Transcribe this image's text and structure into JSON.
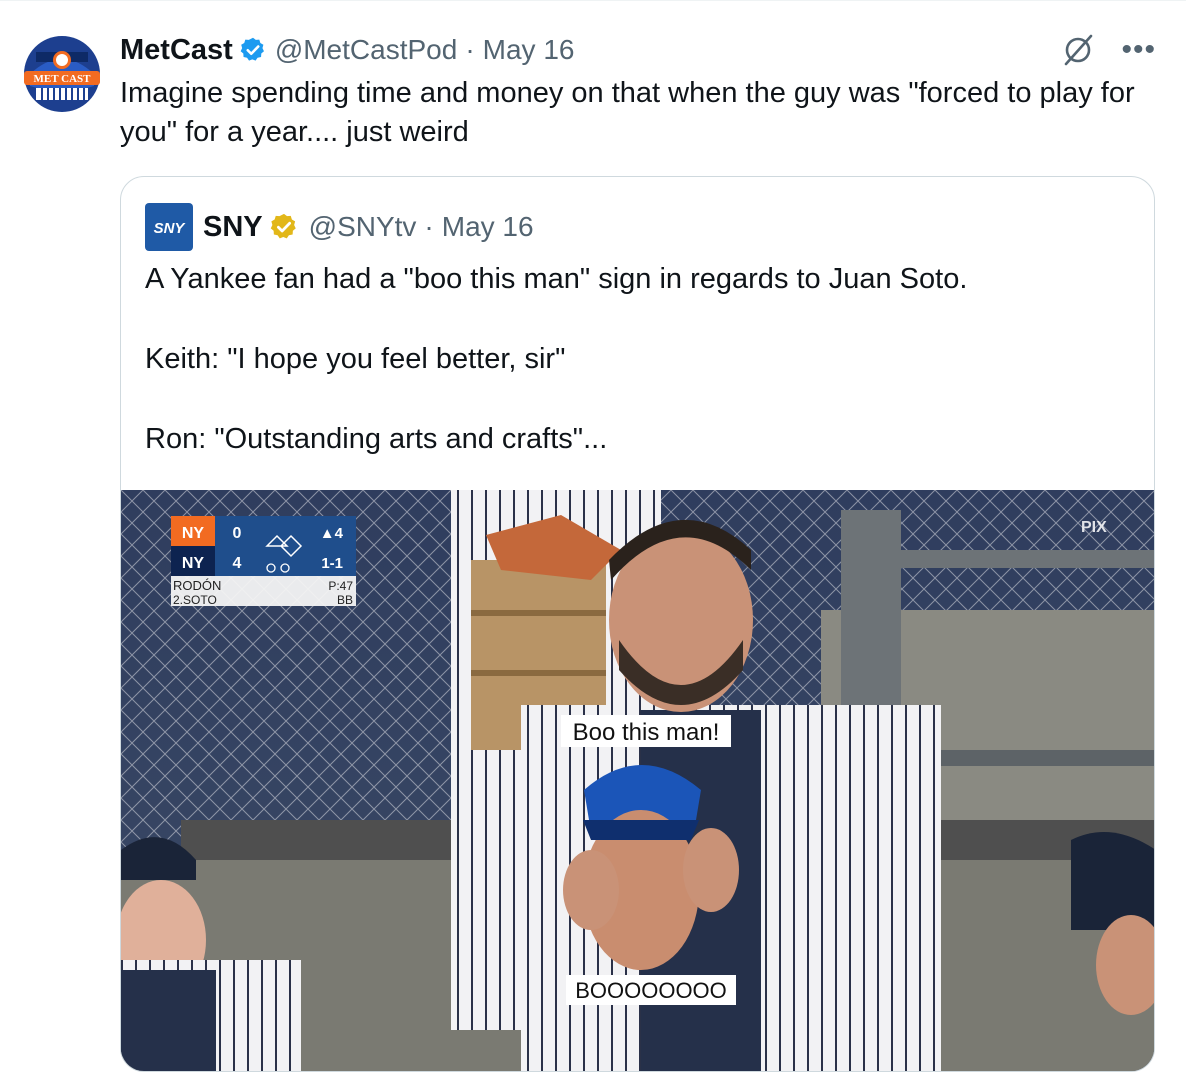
{
  "tweet": {
    "author_name": "MetCast",
    "handle": "@MetCastPod",
    "separator": "·",
    "date": "May 16",
    "text": "Imagine spending time and money on that when the guy was \"forced to play for you\" for a year.... just weird",
    "avatar_text": "MET CAST"
  },
  "quoted": {
    "author_name": "SNY",
    "logo_text": "SNY",
    "handle": "@SNYtv",
    "separator": "·",
    "date": "May 16",
    "lines": [
      "A Yankee fan had a \"boo this man\" sign in regards to Juan Soto.",
      "Keith: \"I hope you feel better, sir\"",
      "Ron: \"Outstanding arts and crafts\"..."
    ]
  },
  "media": {
    "network_bug": "PIX",
    "sign_top": "Boo this man!",
    "sign_bottom": "BOOOOOOOO",
    "scorebug": {
      "away_score": "0",
      "home_score": "4",
      "inning": "▲4",
      "count": "1-1",
      "pitcher": "RODÓN",
      "batter": "2.SOTO",
      "pitch_count": "P:47",
      "result": "BB"
    }
  },
  "icons": {
    "verified_blue": "verified-badge-icon",
    "verified_gold": "gold-verified-badge-icon",
    "grok": "grok-icon",
    "more": "more-icon"
  },
  "colors": {
    "verified_blue": "#1d9bf0",
    "verified_gold": "#e2b719",
    "sny_blue": "#1f5aa6",
    "secondary_text": "#536471",
    "border": "#cfd9de"
  }
}
